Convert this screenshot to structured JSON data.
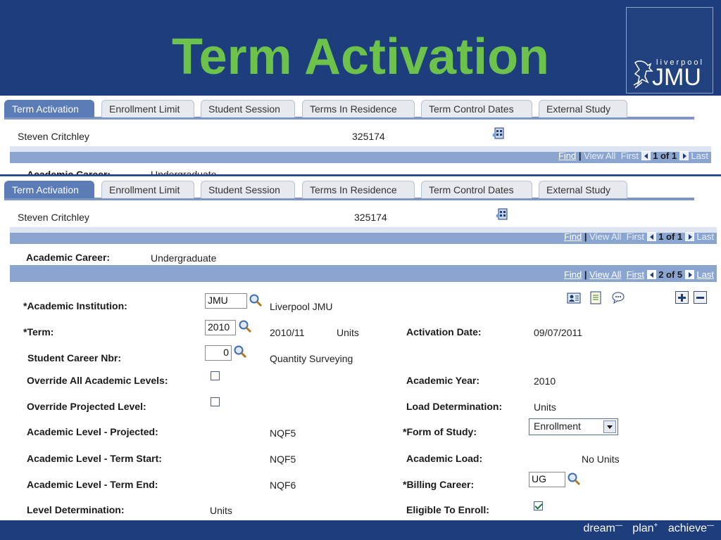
{
  "slide": {
    "title": "Term Activation",
    "logo": {
      "small_text": "liverpool",
      "big_text": "JMU"
    },
    "footer": {
      "word1": "dream",
      "word2": "plan",
      "word3": "achieve"
    }
  },
  "tabs": [
    {
      "label": "Term Activation",
      "active": true
    },
    {
      "label": "Enrollment Limit",
      "active": false
    },
    {
      "label": "Student Session",
      "active": false
    },
    {
      "label": "Terms In Residence",
      "active": false
    },
    {
      "label": "Term Control Dates",
      "active": false
    },
    {
      "label": "External Study",
      "active": false
    }
  ],
  "student": {
    "name": "Steven Critchley",
    "id": "325174"
  },
  "nav_top": {
    "find": "Find",
    "sep": "|",
    "view_all": "View All",
    "first": "First",
    "position": "1 of 1",
    "last": "Last"
  },
  "career": {
    "label": "Academic Career:",
    "value": "Undergraduate"
  },
  "back_career_fragment": {
    "label": "Academic Career:",
    "value": "Undergraduate"
  },
  "nav_career": {
    "find": "Find",
    "sep": "|",
    "view_all": "View All",
    "first": "First",
    "position": "2 of 5",
    "last": "Last"
  },
  "form": {
    "institution": {
      "label": "*Academic Institution:",
      "value": "JMU",
      "description": "Liverpool JMU"
    },
    "term": {
      "label": "*Term:",
      "value": "2010",
      "description": "2010/11",
      "units": "Units"
    },
    "career_nbr": {
      "label": "Student Career Nbr:",
      "value": "0",
      "description": "Quantity Surveying"
    },
    "override_all": {
      "label": "Override All Academic Levels:",
      "checked": false
    },
    "override_projected": {
      "label": "Override Projected Level:",
      "checked": false
    },
    "level_projected": {
      "label": "Academic Level - Projected:",
      "value": "NQF5"
    },
    "level_start": {
      "label": "Academic Level - Term Start:",
      "value": "NQF5"
    },
    "level_end": {
      "label": "Academic Level - Term End:",
      "value": "NQF6"
    },
    "level_determination": {
      "label": "Level Determination:",
      "value": "Units"
    },
    "activation_date": {
      "label": "Activation Date:",
      "value": "09/07/2011"
    },
    "academic_year": {
      "label": "Academic Year:",
      "value": "2010"
    },
    "load_determination": {
      "label": "Load Determination:",
      "value": "Units"
    },
    "form_of_study": {
      "label": "*Form of Study:",
      "value": "Enrollment"
    },
    "academic_load": {
      "label": "Academic Load:",
      "value": "No Units"
    },
    "billing_career": {
      "label": "*Billing Career:",
      "value": "UG"
    },
    "eligible": {
      "label": "Eligible To Enroll:",
      "checked": true
    }
  }
}
